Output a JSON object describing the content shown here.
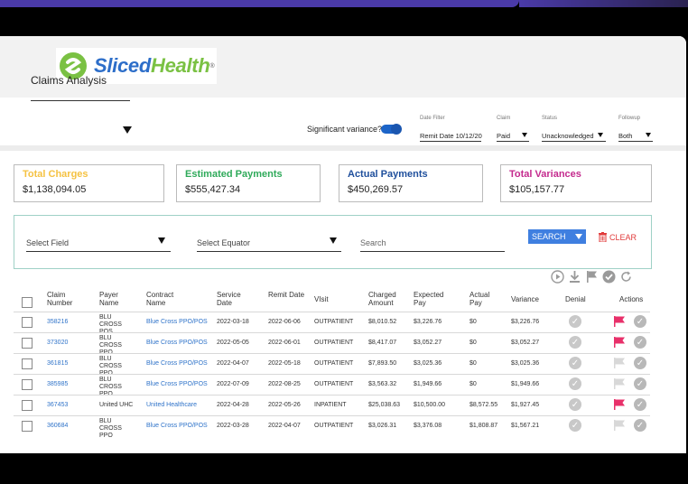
{
  "app": {
    "logo_text_a": "Sliced",
    "logo_text_b": "Health",
    "title": "Claims Analysis"
  },
  "filters": {
    "significant_label": "Significant variance?",
    "significant_on": true,
    "date_filter_label": "Date Filter",
    "date_filter_value": "Remit Date 10/12/20",
    "claim_label": "Claim",
    "claim_value": "Paid",
    "status_label": "Status",
    "status_value": "Unacknowledged",
    "followup_label": "Followup",
    "followup_value": "Both"
  },
  "cards": [
    {
      "title": "Total Charges",
      "value": "$1,138,094.05",
      "color": "#f5c242"
    },
    {
      "title": "Estimated Payments",
      "value": "$555,427.34",
      "color": "#2faa5a"
    },
    {
      "title": "Actual Payments",
      "value": "$450,269.57",
      "color": "#1f4f9c"
    },
    {
      "title": "Total Variances",
      "value": "$105,157.77",
      "color": "#c42b8e"
    }
  ],
  "search": {
    "select_field": "Select Field",
    "select_equator": "Select Equator",
    "search_placeholder": "Search",
    "search_button": "SEARCH",
    "clear_button": "CLEAR"
  },
  "table": {
    "headers": {
      "claim": "Claim Number",
      "payer": "Payer Name",
      "contract": "Contract Name",
      "service": "Service Date",
      "remit": "Remit Date",
      "visit": "VIsit",
      "charged": "Charged Amount",
      "expected": "Expected Pay",
      "actual": "Actual Pay",
      "variance": "Variance",
      "denial": "Denial",
      "actions": "Actions"
    },
    "rows": [
      {
        "claim": "358216",
        "payer": "BLU CROSS POS",
        "contract": "Blue Cross PPO/POS",
        "service": "2022-03-18",
        "remit": "2022-06-06",
        "visit": "OUTPATIENT",
        "charged": "$8,010.52",
        "expected": "$3,226.76",
        "actual": "$0",
        "variance": "$3,226.76",
        "flag": "red"
      },
      {
        "claim": "373020",
        "payer": "BLU CROSS PPO",
        "contract": "Blue Cross PPO/POS",
        "service": "2022-05-05",
        "remit": "2022-06-01",
        "visit": "OUTPATIENT",
        "charged": "$8,417.07",
        "expected": "$3,052.27",
        "actual": "$0",
        "variance": "$3,052.27",
        "flag": "red"
      },
      {
        "claim": "361815",
        "payer": "BLU CROSS PPO",
        "contract": "Blue Cross PPO/POS",
        "service": "2022-04-07",
        "remit": "2022-05-18",
        "visit": "OUTPATIENT",
        "charged": "$7,893.50",
        "expected": "$3,025.36",
        "actual": "$0",
        "variance": "$3,025.36",
        "flag": "gray"
      },
      {
        "claim": "385985",
        "payer": "BLU CROSS PPO",
        "contract": "Blue Cross PPO/POS",
        "service": "2022-07-09",
        "remit": "2022-08-25",
        "visit": "OUTPATIENT",
        "charged": "$3,563.32",
        "expected": "$1,949.66",
        "actual": "$0",
        "variance": "$1,949.66",
        "flag": "gray"
      },
      {
        "claim": "367453",
        "payer": "United UHC",
        "contract": "United Healthcare",
        "service": "2022-04-28",
        "remit": "2022-05-26",
        "visit": "INPATIENT",
        "charged": "$25,038.63",
        "expected": "$10,500.00",
        "actual": "$8,572.55",
        "variance": "$1,927.45",
        "flag": "red"
      },
      {
        "claim": "360684",
        "payer": "BLU CROSS PPO",
        "contract": "Blue Cross PPO/POS",
        "service": "2022-03-28",
        "remit": "2022-04-07",
        "visit": "OUTPATIENT",
        "charged": "$3,026.31",
        "expected": "$3,376.08",
        "actual": "$1,808.87",
        "variance": "$1,567.21",
        "flag": "gray"
      }
    ]
  },
  "colors": {
    "accent_blue": "#3f7fe0",
    "flag_red": "#e8306a",
    "flag_gray": "#d8d8d8"
  }
}
